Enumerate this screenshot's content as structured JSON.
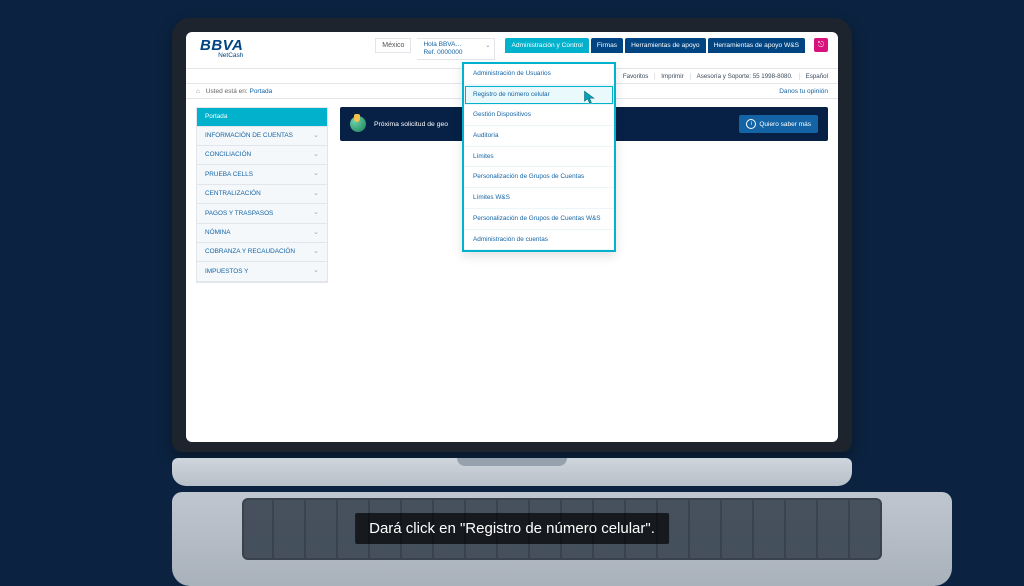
{
  "brand": {
    "name": "BBVA",
    "product": "NetCash"
  },
  "top": {
    "country": "México",
    "greeting": "Hola BBVA…",
    "ref": "Ref. 0000000"
  },
  "tabs": [
    "Administración y Control",
    "Firmas",
    "Herramientas de apoyo",
    "Herramientas de apoyo W&S"
  ],
  "util": {
    "favoritos": "Favoritos",
    "imprimir": "Imprimir",
    "soporte": "Asesoría y Soporte: 55 1998-8080.",
    "idioma": "Español"
  },
  "crumb": {
    "label": "Usted está en:",
    "here": "Portada",
    "opinion": "Danos tu opinión"
  },
  "sidebar": [
    {
      "label": "Portada",
      "active": true
    },
    {
      "label": "INFORMACIÓN DE CUENTAS"
    },
    {
      "label": "CONCILIACIÓN"
    },
    {
      "label": "PRUEBA CELLS"
    },
    {
      "label": "CENTRALIZACIÓN"
    },
    {
      "label": "PAGOS Y TRASPASOS"
    },
    {
      "label": "NÓMINA"
    },
    {
      "label": "COBRANZA Y RECAUDACIÓN"
    },
    {
      "label": "IMPUESTOS Y"
    }
  ],
  "banner": {
    "text": "Próxima solicitud de geo",
    "cta": "Quiero saber más"
  },
  "dropdown": [
    "Administración de Usuarios",
    "Registro de número celular",
    "Gestión Dispositivos",
    "Auditoría",
    "Límites",
    "Personalización de Grupos de Cuentas",
    "Límites W&S",
    "Personalización de Grupos de Cuentas W&S",
    "Administración de cuentas"
  ],
  "dropdown_hover_index": 1,
  "caption": "Dará click en \"Registro de número celular\"."
}
